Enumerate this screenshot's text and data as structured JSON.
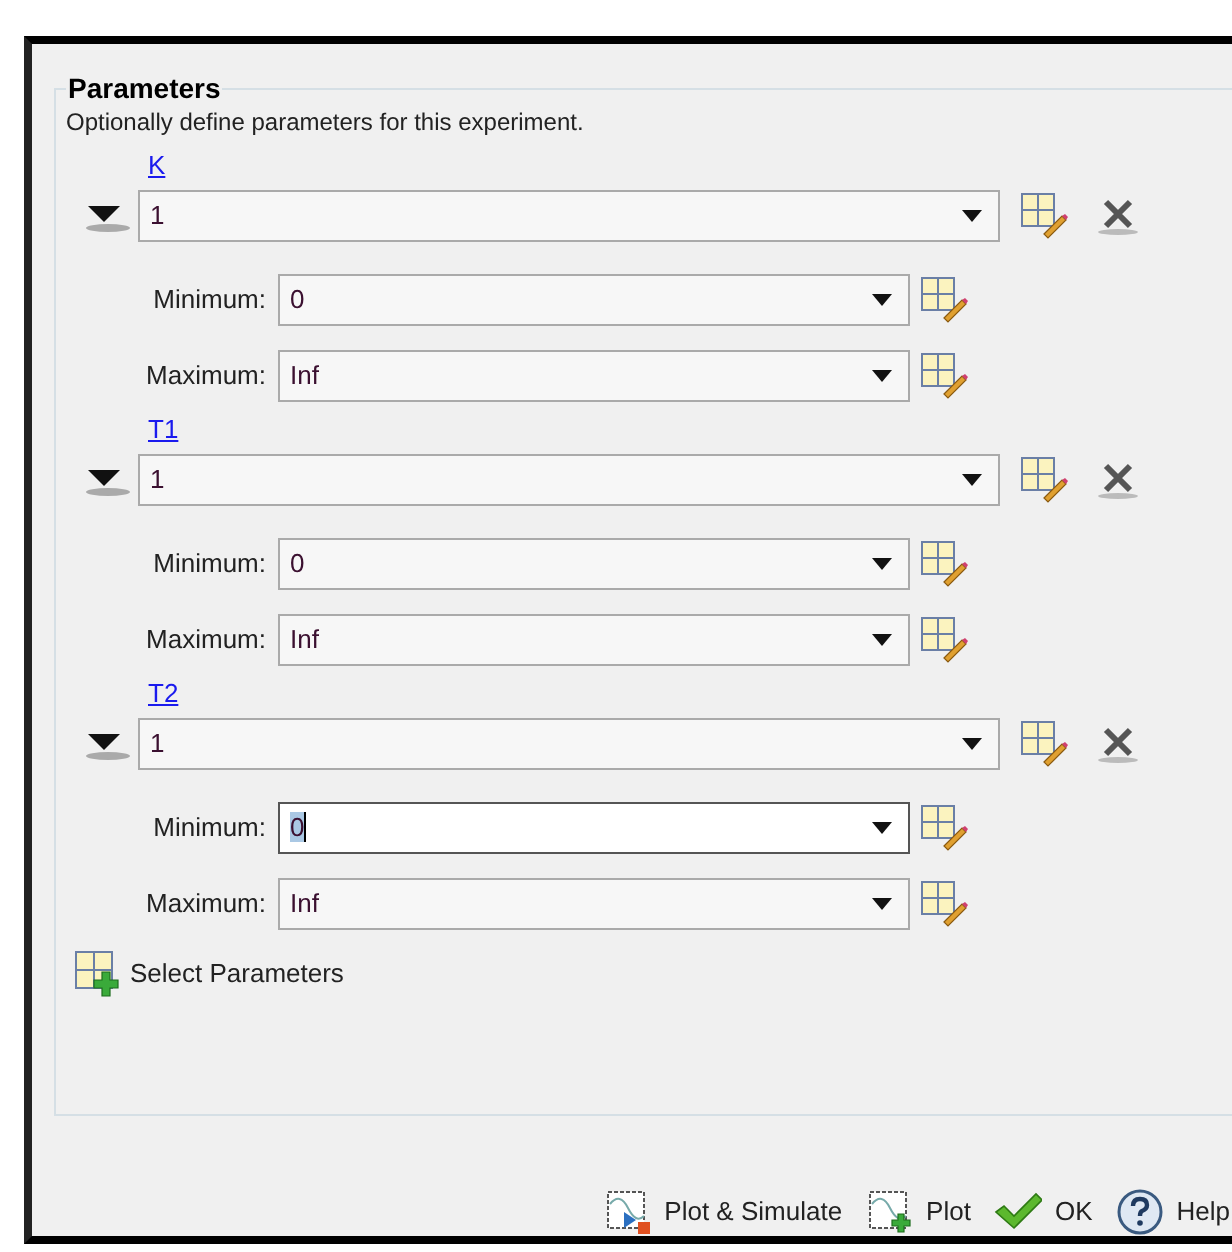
{
  "group": {
    "title": "Parameters",
    "description": "Optionally define parameters for this experiment."
  },
  "parameters": [
    {
      "name": "K",
      "expanded": true,
      "value": "1",
      "minimum": {
        "label": "Minimum:",
        "value": "0",
        "focused": false
      },
      "maximum": {
        "label": "Maximum:",
        "value": "Inf",
        "focused": false
      }
    },
    {
      "name": "T1",
      "expanded": true,
      "value": "1",
      "minimum": {
        "label": "Minimum:",
        "value": "0",
        "focused": false
      },
      "maximum": {
        "label": "Maximum:",
        "value": "Inf",
        "focused": false
      }
    },
    {
      "name": "T2",
      "expanded": true,
      "value": "1",
      "minimum": {
        "label": "Minimum:",
        "value": "0",
        "focused": true
      },
      "maximum": {
        "label": "Maximum:",
        "value": "Inf",
        "focused": false
      }
    }
  ],
  "select_button": "Select Parameters",
  "buttons": [
    {
      "kind": "plotsim",
      "label": "Plot & Simulate"
    },
    {
      "kind": "plot",
      "label": "Plot"
    },
    {
      "kind": "ok",
      "label": "OK"
    },
    {
      "kind": "help",
      "label": "Help"
    }
  ]
}
